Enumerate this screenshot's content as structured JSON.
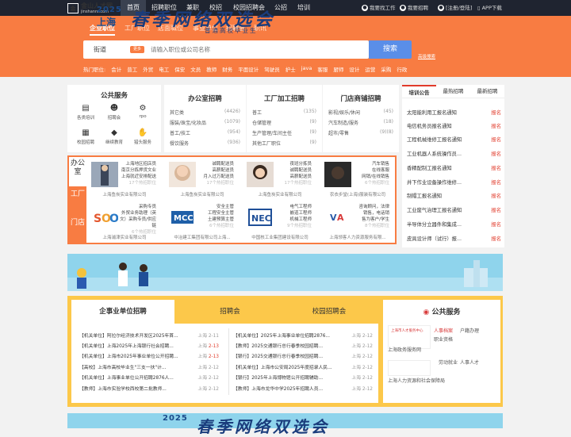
{
  "topnav": {
    "logo_text": "金山人才网",
    "logo_sub": "jinshanrc.com",
    "items": [
      "首页",
      "招聘职位",
      "兼职",
      "校招",
      "校园招聘会",
      "公招",
      "培训"
    ],
    "right": [
      "我要找工作",
      "我要招聘",
      "[注册/登陆]",
      "APP下载"
    ]
  },
  "search": {
    "tabs": [
      "企业职位",
      "工厂职位",
      "店面職位",
      "事业单位",
      "招聘会",
      "职讯"
    ],
    "city": "街道",
    "city_btn": "更多",
    "placeholder": "请输入职位或公司名称",
    "button": "搜索",
    "advanced": "高级搜索",
    "hot_label": "热门职位:",
    "hot": [
      "会计",
      "普工",
      "外贸",
      "电工",
      "保安",
      "文员",
      "教师",
      "财务",
      "平面设计",
      "驾驶员",
      "护士",
      "java",
      "客服",
      "厨师",
      "设计",
      "运营",
      "采购",
      "行政"
    ]
  },
  "public_service": {
    "title": "公共服务",
    "items": [
      "各类培训",
      "招聘会",
      "rpo",
      "校园招聘",
      "继续教育",
      "猎头服务"
    ]
  },
  "categories": [
    {
      "title": "办公室招聘",
      "rows": [
        [
          "其它类",
          "(4426)"
        ],
        [
          "服装/珠宝/化妆品",
          "(1079)"
        ],
        [
          "普工/技工",
          "(954)"
        ],
        [
          "餐饮服务",
          "(936)"
        ]
      ]
    },
    {
      "title": "工厂加工招聘",
      "rows": [
        [
          "普工",
          "(135)"
        ],
        [
          "仓储管理",
          "(9)"
        ],
        [
          "生产管理/车间主任",
          "(9)"
        ],
        [
          "其他工厂职位",
          "(9)"
        ]
      ]
    },
    {
      "title": "门店商铺招聘",
      "rows": [
        [
          "影视/娱乐/休闲",
          "(45)"
        ],
        [
          "汽车制造/服务",
          "(18)"
        ],
        [
          "超市/零售",
          "(9)(8)"
        ],
        [
          "",
          ""
        ]
      ]
    }
  ],
  "notice": {
    "tabs": [
      "培训公告",
      "最热招聘",
      "最新招聘"
    ],
    "tag": "报名",
    "items": [
      "太阳能利用工报名通知",
      "电信机务员报名通知",
      "工程机械维修工报名通知",
      "工业机器人系统操作员...",
      "香精配制工报名通知",
      "井下作业设备操作维修...",
      "制帽工报名通知",
      "工业废气治理工报名通知",
      "半导体分立器件和集成...",
      "皮具设计师（试行）报..."
    ]
  },
  "jobs": {
    "side": [
      "办公室",
      "工厂",
      "门店"
    ],
    "companies": [
      {
        "lines": [
          "上海地区招店员",
          "南京分拣押货文业",
          "上海就近安排配送"
        ],
        "hot": "17个热招职位",
        "name": "上海鱼炭实业有限公司"
      },
      {
        "lines": [
          "诚聘配送员",
          "高薪配送员",
          "月入过万配送员"
        ],
        "hot": "17个热招职位",
        "name": "上海鱼炭实业有限公司"
      },
      {
        "lines": [
          "夜班分拣员",
          "诚聘配送员",
          "高薪配送员"
        ],
        "hot": "17个热招职位",
        "name": "上海鱼炭实业有限公司"
      },
      {
        "lines": [
          "汽车销售",
          "在线客服",
          "网销/在线销售"
        ],
        "hot": "6个热招职位",
        "name": "农衣步堂(上海)服装有限公司"
      },
      {
        "lines": [
          "采购专员",
          "外贸业务助理（英",
          "文）采购专员/供应链"
        ],
        "hot": "6个热招职位",
        "name": "上海浦津实业有限公司"
      },
      {
        "lines": [
          "安全主管",
          "工程安全主管",
          "土建预算主管"
        ],
        "hot": "6个热招职位",
        "name": "中冶建工集团有限公司上海..."
      },
      {
        "lines": [
          "电气工程师",
          "嵌道工程师",
          "机械工程师"
        ],
        "hot": "9个热招职位",
        "name": "中国核工业集团建设有限公司"
      },
      {
        "lines": [
          "咨询顾问，法律",
          "销售，电话销",
          "售为客户/学生"
        ],
        "hot": "8个热招职位",
        "name": "上海领客人力资源服务有限..."
      }
    ]
  },
  "banner": {
    "year": "2025",
    "city": "上海",
    "title": "春季网络双选会",
    "subtitle": "普通高校毕业生"
  },
  "recruit": {
    "tabs": [
      "企事业单位招聘",
      "招聘会",
      "校园招聘会"
    ],
    "left": [
      [
        "【机关单位】阿拉尔经济技术开发区2025年首...",
        "上海",
        "2-11",
        false
      ],
      [
        "【机关单位】上海2025年上海银行社会招聘...",
        "上海",
        "2-13",
        true
      ],
      [
        "【机关单位】上海市2025年事业单位公开招聘...",
        "上海",
        "2-13",
        true
      ],
      [
        "【高校】上海市高校毕业生\"三支一扶\"计...",
        "上海",
        "2-12",
        false
      ],
      [
        "【机关单位】上海事业单位公开招聘2876人...",
        "上海",
        "2-12",
        false
      ],
      [
        "【教师】上海市实验学校西校第二批教师...",
        "上海",
        "2-12",
        false
      ]
    ],
    "right": [
      [
        "【机关单位】2025年上海事业单位招聘2876...",
        "上海",
        "2-12",
        false
      ],
      [
        "【教师】2025交通银行总行春季校园招聘...",
        "上海",
        "2-12",
        false
      ],
      [
        "【银行】2025交通银行总行春季校园招聘...",
        "上海",
        "2-12",
        false
      ],
      [
        "【机关单位】上海市公安局2025年度招录人民...",
        "上海",
        "2-12",
        false
      ],
      [
        "【银行】2025年上海博物馆公开招聘辅助...",
        "上海",
        "2-12",
        false
      ],
      [
        "【教师】上海市龙华中学2025年招聘人员...",
        "上海",
        "2-12",
        false
      ]
    ],
    "pub": {
      "title": "公共服务",
      "links": [
        "人事档案",
        "户籍办理",
        "职业资格",
        "劳动就业",
        "人事人才"
      ],
      "org1": "上海市人才服务中心",
      "org1b": "上海政务服务网",
      "org2": "上海人力资源和社会保障局"
    }
  }
}
